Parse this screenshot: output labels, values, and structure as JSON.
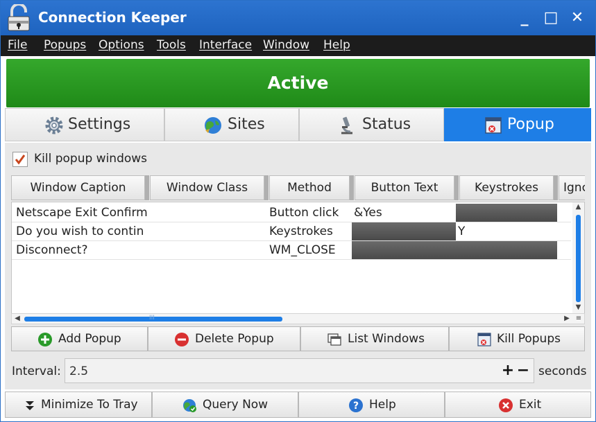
{
  "window": {
    "title": "Connection Keeper",
    "minimize_glyph": "_",
    "maximize_glyph": "□",
    "close_glyph": "✕"
  },
  "menu": [
    "File",
    "Popups",
    "Options",
    "Tools",
    "Interface",
    "Window",
    "Help"
  ],
  "status_banner": {
    "text": "Active",
    "color": "#27991f"
  },
  "tabs": [
    {
      "label": "Settings",
      "icon": "gear-icon"
    },
    {
      "label": "Sites",
      "icon": "globe-icon"
    },
    {
      "label": "Status",
      "icon": "microscope-icon"
    },
    {
      "label": "Popup",
      "icon": "popup-window-icon",
      "active": true
    }
  ],
  "popup_panel": {
    "kill_checkbox": {
      "label": "Kill popup windows",
      "checked": true
    },
    "columns": [
      "Window Caption",
      "Window Class",
      "Method",
      "Button Text",
      "Keystrokes",
      "Ignc"
    ],
    "rows": [
      {
        "caption": "Netscape Exit Confirm",
        "method": "Button click",
        "button_text": "&Yes",
        "keystrokes": ""
      },
      {
        "caption": "Do you wish to contin",
        "method": "Keystrokes",
        "button_text": "",
        "keystrokes": "Y"
      },
      {
        "caption": "Disconnect?",
        "method": "WM_CLOSE",
        "button_text": "",
        "keystrokes": ""
      }
    ],
    "hscroll_grip": "III",
    "actions": [
      {
        "label": "Add Popup",
        "icon": "add-icon"
      },
      {
        "label": "Delete Popup",
        "icon": "delete-icon"
      },
      {
        "label": "List Windows",
        "icon": "list-windows-icon"
      },
      {
        "label": "Kill Popups",
        "icon": "kill-popups-icon"
      }
    ],
    "interval": {
      "label": "Interval:",
      "value": "2.5",
      "plus": "+",
      "minus": "−",
      "unit": "seconds"
    }
  },
  "bottom_buttons": [
    {
      "label": "Minimize To Tray",
      "icon": "minimize-tray-icon"
    },
    {
      "label": "Query Now",
      "icon": "query-globe-icon"
    },
    {
      "label": "Help",
      "icon": "help-icon"
    },
    {
      "label": "Exit",
      "icon": "exit-icon"
    }
  ],
  "colors": {
    "accent": "#1e7ee6",
    "titlebar": "#2468c8",
    "menubar": "#1c1c1c",
    "active_green": "#27991f"
  }
}
